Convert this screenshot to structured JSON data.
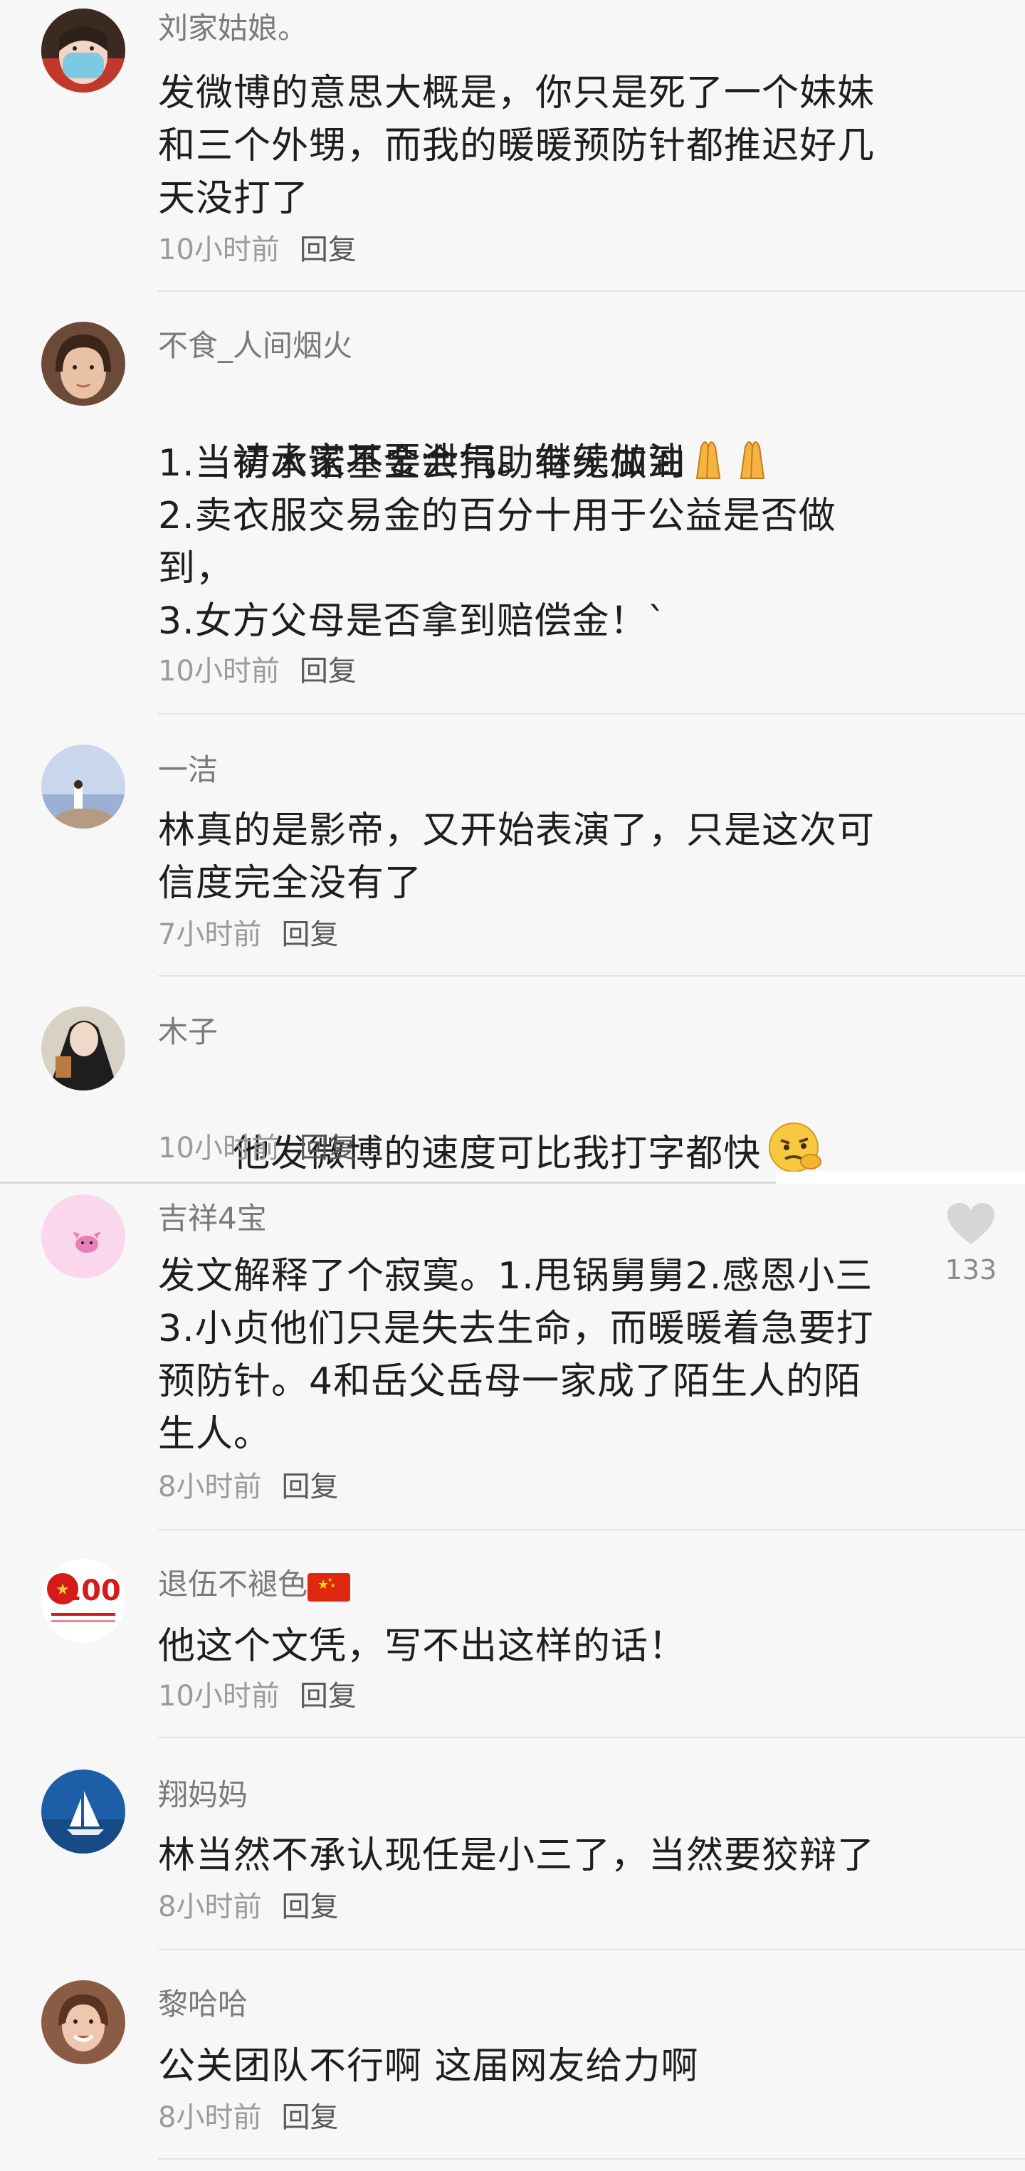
{
  "comments": [
    {
      "username": "刘家姑娘。",
      "text": "发微博的意思大概是，你只是死了一个妹妹\n和三个外甥，而我的暖暖预防针都推迟好几\n天没打了",
      "time": "10小时前",
      "reply": "回复"
    },
    {
      "username": "不食_人间烟火",
      "text": "请大家不要泄气。继续加油",
      "text_extra": "1.当初承诺基金会捐助有无做到\n2.卖衣服交易金的百分十用于公益是否做\n到，\n3.女方父母是否拿到赔偿金！`",
      "emoji": "pray-emoji",
      "time": "10小时前",
      "reply": "回复"
    },
    {
      "username": "一洁",
      "text": "林真的是影帝，又开始表演了，只是这次可\n信度完全没有了",
      "time": "7小时前",
      "reply": "回复"
    },
    {
      "username": "木子",
      "text": "他发微博的速度可比我打字都快",
      "emoji": "thinking-emoji",
      "time": "10小时前",
      "reply": "回复"
    },
    {
      "username": "吉祥4宝",
      "text": "发文解释了个寂寞。1.甩锅舅舅2.感恩小三\n3.小贞他们只是失去生命，而暖暖着急要打\n预防针。4和岳父岳母一家成了陌生人的陌\n生人。",
      "time": "8小时前",
      "reply": "回复",
      "likes": "133"
    },
    {
      "username": "退伍不褪色",
      "flag": "china-flag-emoji",
      "text": "他这个文凭，写不出这样的话！",
      "time": "10小时前",
      "reply": "回复"
    },
    {
      "username": "翔妈妈",
      "text": "林当然不承认现任是小三了，当然要狡辩了",
      "time": "8小时前",
      "reply": "回复"
    },
    {
      "username": "黎哈哈",
      "text": "公关团队不行啊 这届网友给力啊",
      "time": "8小时前",
      "reply": "回复"
    }
  ],
  "colors": {
    "background": "#f7f7f7",
    "username": "#7a7a7a",
    "body": "#1e1e1e",
    "meta": "#9b9b9b",
    "divider": "#e4e4e4"
  }
}
